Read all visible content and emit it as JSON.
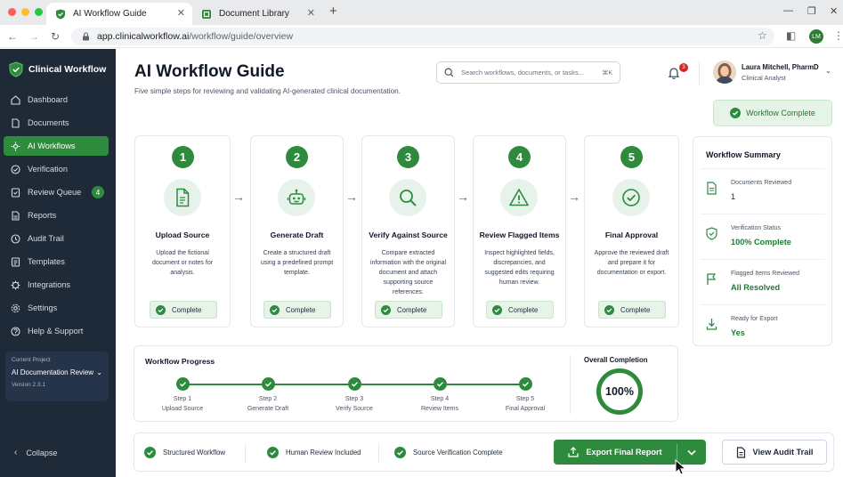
{
  "browser": {
    "tabs": [
      {
        "label": "AI Workflow Guide",
        "active": true
      },
      {
        "label": "Document Library",
        "active": false
      }
    ],
    "url_host": "app.clinicalworkflow.ai",
    "url_path": "/workflow/guide/overview",
    "profile_initials": "LM"
  },
  "sidebar": {
    "brand": "Clinical Workflow",
    "items": [
      {
        "label": "Dashboard",
        "icon": "home-icon"
      },
      {
        "label": "Documents",
        "icon": "document-icon"
      },
      {
        "label": "AI Workflows",
        "icon": "workflow-icon",
        "active": true
      },
      {
        "label": "Verification",
        "icon": "check-circle-icon"
      },
      {
        "label": "Review Queue",
        "icon": "review-icon",
        "badge": "4"
      },
      {
        "label": "Reports",
        "icon": "report-icon"
      },
      {
        "label": "Audit Trail",
        "icon": "clock-icon"
      },
      {
        "label": "Templates",
        "icon": "template-icon"
      },
      {
        "label": "Integrations",
        "icon": "puzzle-icon"
      },
      {
        "label": "Settings",
        "icon": "gear-icon"
      },
      {
        "label": "Help & Support",
        "icon": "help-icon"
      }
    ],
    "project": {
      "label": "Current Project",
      "name": "AI Documentation Review",
      "version": "Version 2.3.1"
    },
    "collapse_label": "Collapse"
  },
  "header": {
    "title": "AI Workflow Guide",
    "subtitle": "Five simple steps for reviewing and validating AI-generated clinical documentation.",
    "search_placeholder": "Search workflows, documents, or tasks...",
    "search_shortcut": "⌘K",
    "notification_count": "3",
    "user_name": "Laura Mitchell, PharmD",
    "user_role": "Clinical Analyst",
    "workflow_complete_label": "Workflow Complete"
  },
  "steps": [
    {
      "number": "1",
      "title": "Upload Source",
      "desc": "Upload the fictional document or notes for analysis.",
      "status": "Complete",
      "icon": "file-icon"
    },
    {
      "number": "2",
      "title": "Generate Draft",
      "desc": "Create a structured draft using a predefined prompt template.",
      "status": "Complete",
      "icon": "robot-icon"
    },
    {
      "number": "3",
      "title": "Verify Against Source",
      "desc": "Compare extracted information with the original document and attach supporting source references.",
      "status": "Complete",
      "icon": "magnifier-icon"
    },
    {
      "number": "4",
      "title": "Review Flagged Items",
      "desc": "Inspect highlighted fields, discrepancies, and suggested edits requiring human review.",
      "status": "Complete",
      "icon": "warning-icon"
    },
    {
      "number": "5",
      "title": "Final Approval",
      "desc": "Approve the reviewed draft and prepare it for documentation or export.",
      "status": "Complete",
      "icon": "approve-icon"
    }
  ],
  "summary": {
    "title": "Workflow Summary",
    "rows": [
      {
        "label": "Documents Reviewed",
        "value": "1",
        "icon": "document-icon"
      },
      {
        "label": "Verification Status",
        "value": "100% Complete",
        "icon": "shield-icon"
      },
      {
        "label": "Flagged Items Reviewed",
        "value": "All Resolved",
        "icon": "flag-icon"
      },
      {
        "label": "Ready for Export",
        "value": "Yes",
        "icon": "download-icon"
      }
    ]
  },
  "progress": {
    "title": "Workflow Progress",
    "steps": [
      {
        "step": "Step 1",
        "label": "Upload Source"
      },
      {
        "step": "Step 2",
        "label": "Generate Draft"
      },
      {
        "step": "Step 3",
        "label": "Verify Source"
      },
      {
        "step": "Step 4",
        "label": "Review Items"
      },
      {
        "step": "Step 5",
        "label": "Final Approval"
      }
    ],
    "overall_label": "Overall Completion",
    "overall_value": "100%"
  },
  "bottom": {
    "badges": [
      "Structured Workflow",
      "Human Review Included",
      "Source Verification Complete"
    ],
    "export_label": "Export Final Report",
    "audit_label": "View Audit Trail"
  },
  "colors": {
    "accent": "#2e8b3d",
    "sidebar": "#1e2a38"
  }
}
